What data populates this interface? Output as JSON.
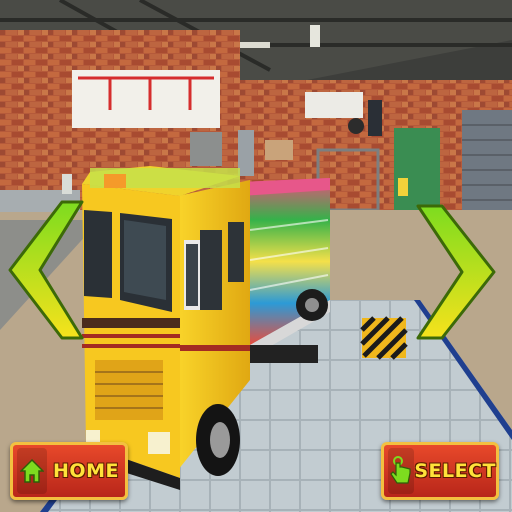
{
  "buttons": {
    "home_label": "HOME",
    "select_label": "SELECT"
  },
  "icons": {
    "home": "home-icon",
    "select": "tap-hand-icon",
    "prev": "chevron-left-icon",
    "next": "chevron-right-icon"
  },
  "colors": {
    "button_fill": "#d03622",
    "button_border": "#f3c040",
    "button_text": "#ffe23a",
    "arrow_green": "#7ddc1f",
    "arrow_yellow": "#f6e21c",
    "truck_yellow": "#f5c518"
  }
}
